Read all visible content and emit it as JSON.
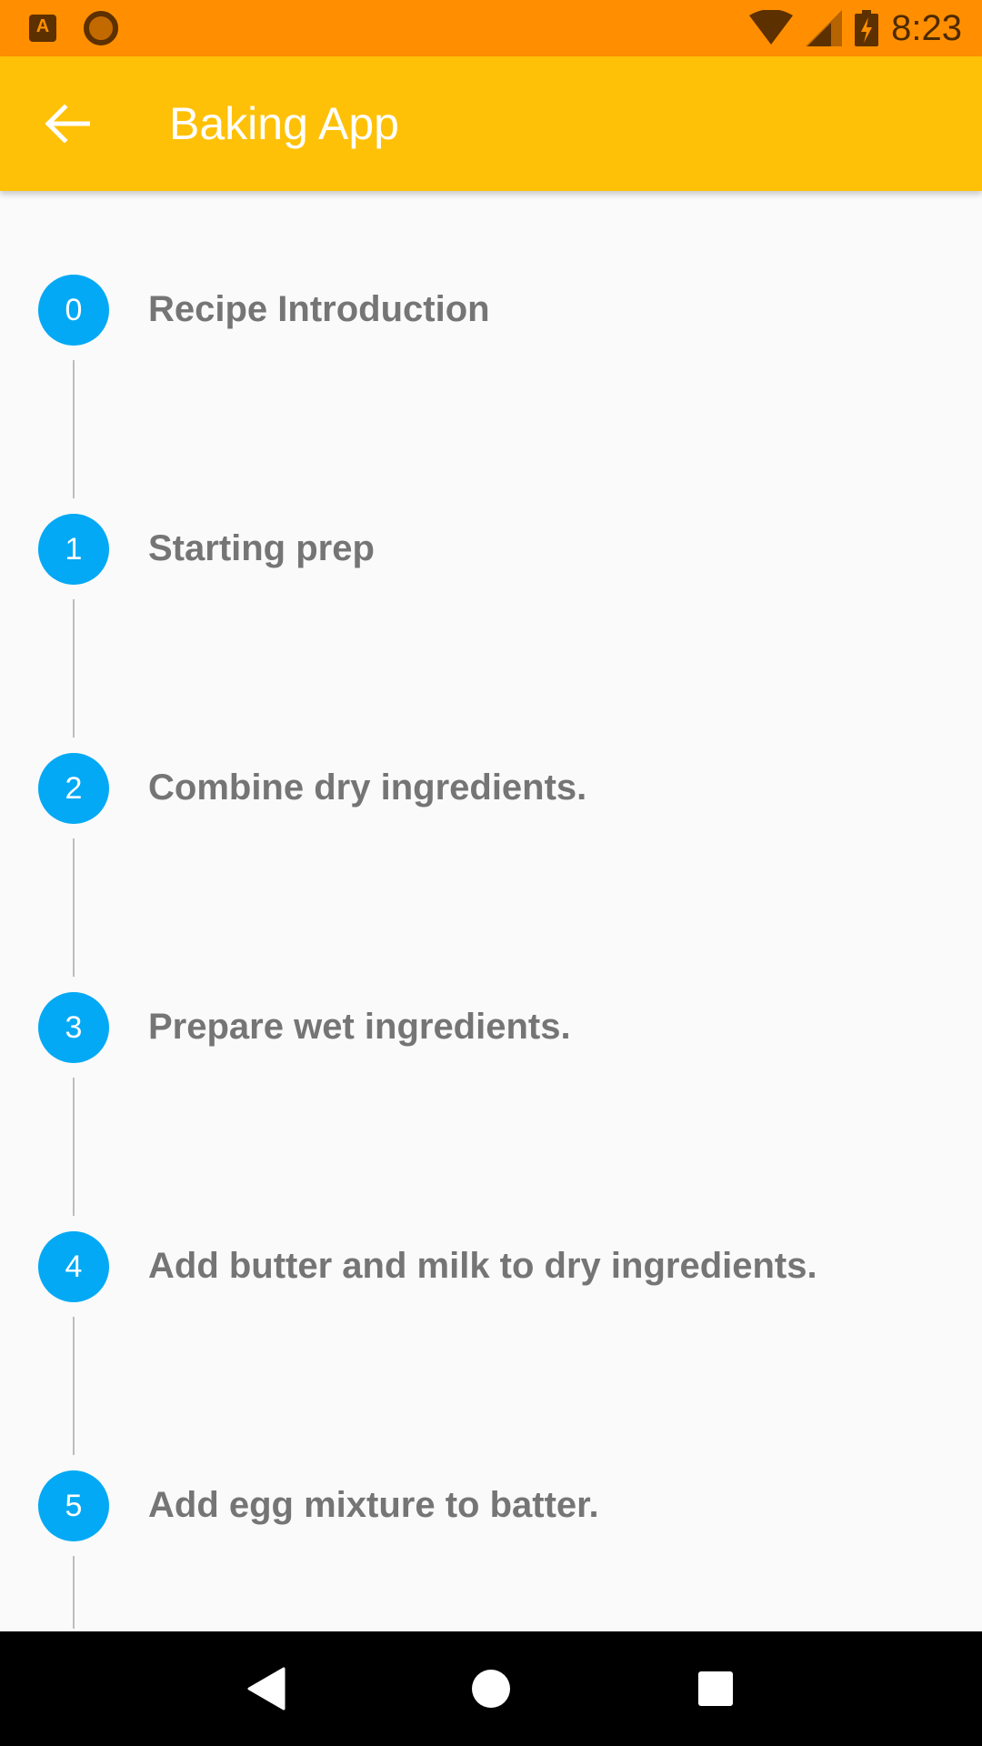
{
  "status_bar": {
    "time": "8:23",
    "left_icons": [
      "a-notification-icon",
      "circle-notification-icon"
    ],
    "right_icons": [
      "wifi-icon",
      "cell-signal-icon",
      "battery-charging-icon"
    ],
    "color": "#ff8f00"
  },
  "app_bar": {
    "title": "Baking App",
    "back_icon": "arrow-back-icon",
    "color": "#ffc107"
  },
  "steps": [
    {
      "number": "0",
      "label": "Recipe Introduction"
    },
    {
      "number": "1",
      "label": "Starting prep"
    },
    {
      "number": "2",
      "label": "Combine dry ingredients."
    },
    {
      "number": "3",
      "label": "Prepare wet ingredients."
    },
    {
      "number": "4",
      "label": "Add butter and milk to dry ingredients."
    },
    {
      "number": "5",
      "label": "Add egg mixture to batter."
    }
  ],
  "step_style": {
    "circle_color": "#03a9f4",
    "label_color": "#757575",
    "connector_color": "#bdbdbd"
  },
  "nav_bar": {
    "buttons": [
      "back-triangle-icon",
      "home-circle-icon",
      "recents-square-icon"
    ]
  }
}
